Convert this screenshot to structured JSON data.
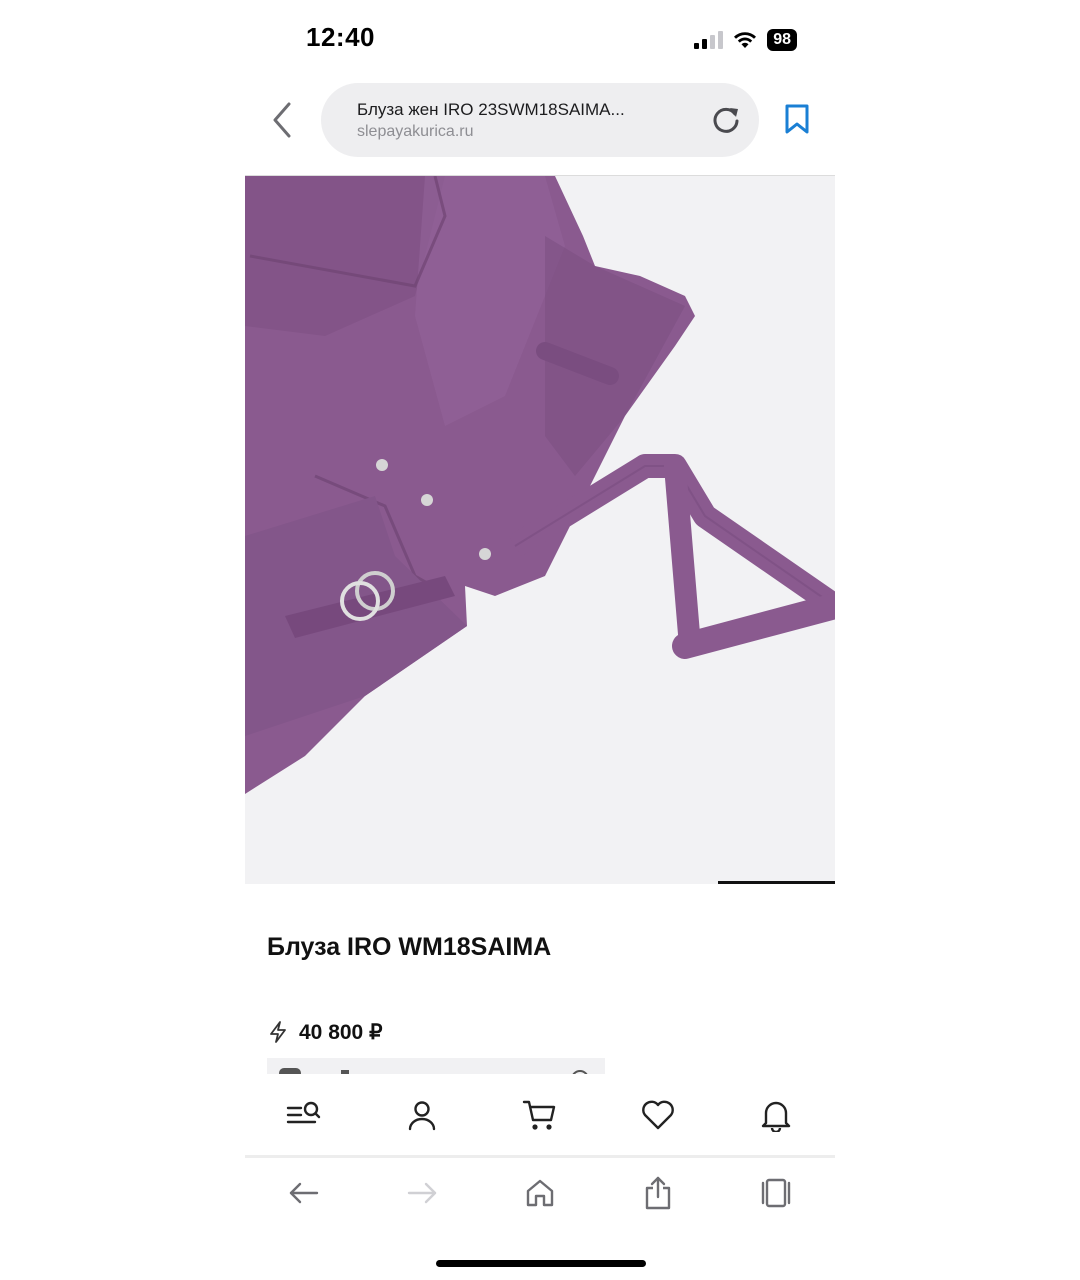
{
  "status_bar": {
    "time": "12:40",
    "battery": "98"
  },
  "browser": {
    "page_title": "Блуза жен IRO 23SWM18SAIMA...",
    "domain": "slepayakurica.ru"
  },
  "product": {
    "title": "Блуза IRO WM18SAIMA",
    "price": "40 800 ₽",
    "image_color": "#8a5a8f"
  },
  "site_nav": {
    "items": [
      "search-menu-icon",
      "profile-icon",
      "cart-icon",
      "favorites-heart-icon",
      "notifications-bell-icon"
    ]
  },
  "browser_toolbar": {
    "items": [
      "back-arrow-icon",
      "forward-arrow-icon",
      "home-icon",
      "share-icon",
      "tabs-icon"
    ]
  },
  "colors": {
    "accent_blue": "#1a7fd4",
    "fabric": "#8a5a8f"
  }
}
